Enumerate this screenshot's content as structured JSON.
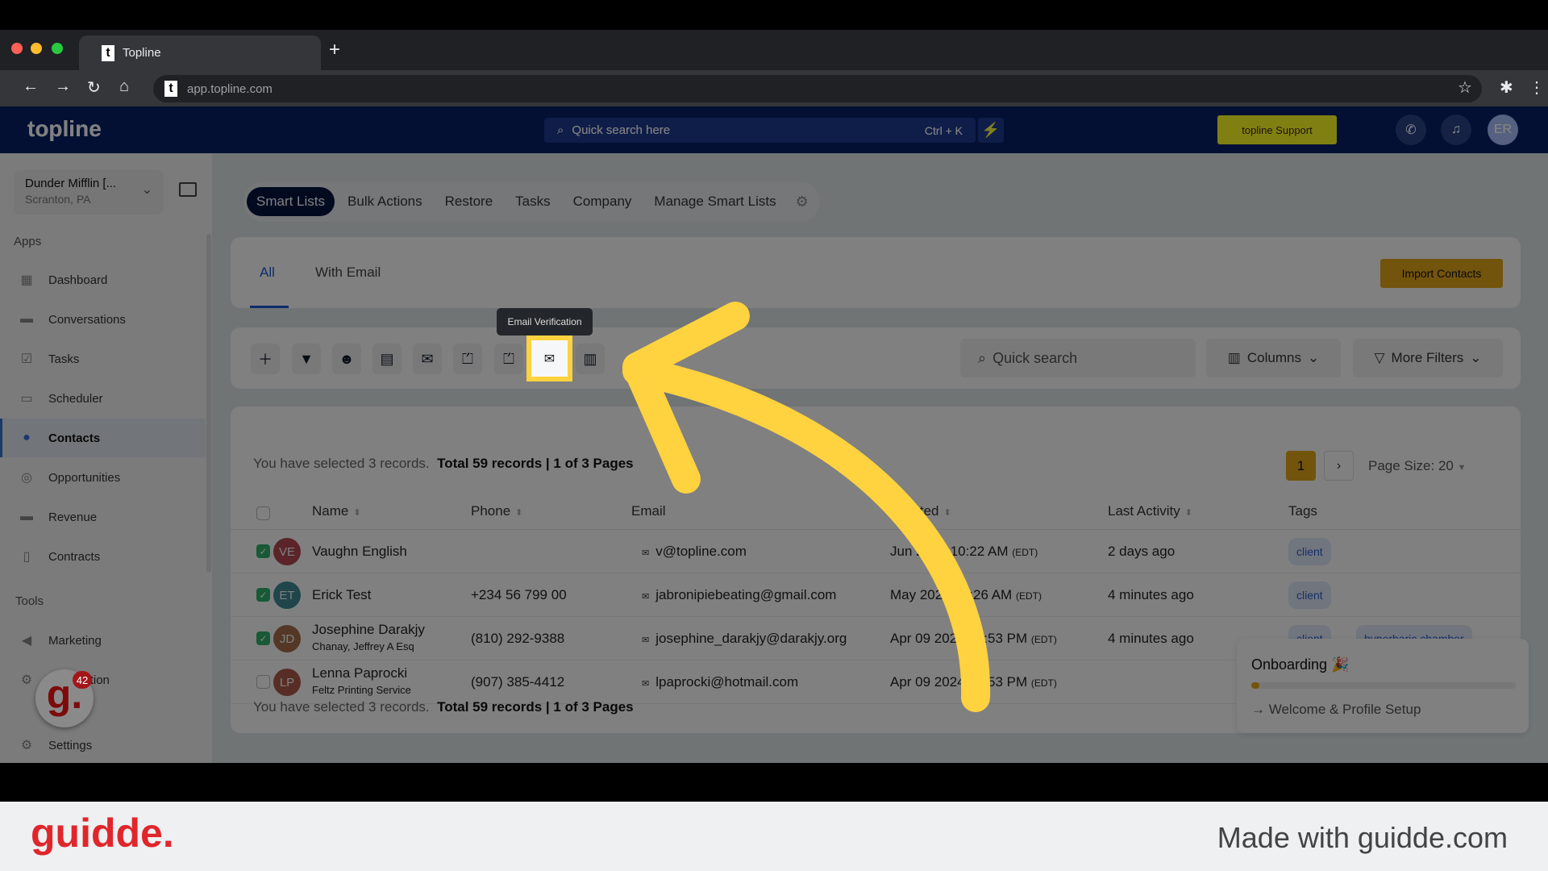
{
  "browser": {
    "tab_title": "Topline",
    "url": "app.topline.com",
    "favicon": "t"
  },
  "header": {
    "logo": "topline",
    "search_placeholder": "Quick search here",
    "search_shortcut": "Ctrl + K",
    "support_label": "topline Support",
    "avatar_initials": "ER"
  },
  "sidebar": {
    "org_name": "Dunder Mifflin [...",
    "org_location": "Scranton, PA",
    "apps_label": "Apps",
    "tools_label": "Tools",
    "apps": [
      {
        "label": "Dashboard",
        "icon": "dashboard-icon"
      },
      {
        "label": "Conversations",
        "icon": "chat-icon"
      },
      {
        "label": "Tasks",
        "icon": "tasks-icon"
      },
      {
        "label": "Scheduler",
        "icon": "calendar-icon"
      },
      {
        "label": "Contacts",
        "icon": "user-icon",
        "active": true
      },
      {
        "label": "Opportunities",
        "icon": "target-icon"
      },
      {
        "label": "Revenue",
        "icon": "card-icon"
      },
      {
        "label": "Contracts",
        "icon": "document-icon"
      }
    ],
    "tools": [
      {
        "label": "Marketing",
        "icon": "megaphone-icon"
      },
      {
        "label": "Automation",
        "icon": "gears-icon"
      }
    ],
    "settings_label": "Settings"
  },
  "nav_tabs": [
    "Smart Lists",
    "Bulk Actions",
    "Restore",
    "Tasks",
    "Company",
    "Manage Smart Lists"
  ],
  "list_tabs": {
    "all": "All",
    "with_email": "With Email"
  },
  "import_label": "Import Contacts",
  "toolbar": {
    "tooltip": "Email Verification",
    "search_placeholder": "Quick search",
    "columns_label": "Columns",
    "filters_label": "More Filters"
  },
  "summary": {
    "selected": "You have selected 3 records.",
    "total": "Total 59 records",
    "pages": "1 of 3 Pages"
  },
  "pagination": {
    "current": "1",
    "page_size": "Page Size: 20"
  },
  "table": {
    "headers": {
      "name": "Name",
      "phone": "Phone",
      "email": "Email",
      "created": "Created",
      "last_activity": "Last Activity",
      "tags": "Tags"
    },
    "rows": [
      {
        "checked": true,
        "initials": "VE",
        "color": "#b3474f",
        "name": "Vaughn English",
        "company": "",
        "phone": "",
        "email": "v@topline.com",
        "created": "Jun 2024 10:22 AM",
        "tz": "(EDT)",
        "activity": "2 days ago",
        "tags": [
          "client"
        ]
      },
      {
        "checked": true,
        "initials": "ET",
        "color": "#3f8a96",
        "name": "Erick Test",
        "company": "",
        "phone": "+234 56 799 00",
        "email": "jabronipiebeating@gmail.com",
        "created": "May 2024 08:26 AM",
        "tz": "(EDT)",
        "activity": "4 minutes ago",
        "tags": [
          "client"
        ]
      },
      {
        "checked": true,
        "initials": "JD",
        "color": "#a9704a",
        "name": "Josephine Darakjy",
        "company": "Chanay, Jeffrey A Esq",
        "phone": "(810) 292-9388",
        "email": "josephine_darakjy@darakjy.org",
        "created": "Apr 09 2024 03:53 PM",
        "tz": "(EDT)",
        "activity": "4 minutes ago",
        "tags": [
          "client",
          "hyperbaric chamber"
        ]
      },
      {
        "checked": false,
        "initials": "LP",
        "color": "#b05a4a",
        "name": "Lenna Paprocki",
        "company": "Feltz Printing Service",
        "phone": "(907) 385-4412",
        "email": "lpaprocki@hotmail.com",
        "created": "Apr 09 2024 03:53 PM",
        "tz": "(EDT)",
        "activity": "",
        "tags": []
      }
    ]
  },
  "onboarding": {
    "title": "Onboarding",
    "progress_percent": 3,
    "step": "Welcome & Profile Setup"
  },
  "guidde": {
    "badge": "42",
    "logo": "guidde.",
    "made_with": "Made with guidde.com"
  },
  "colors": {
    "accent": "#e6a817",
    "annotation": "#ffd23f",
    "header": "#04143f"
  }
}
